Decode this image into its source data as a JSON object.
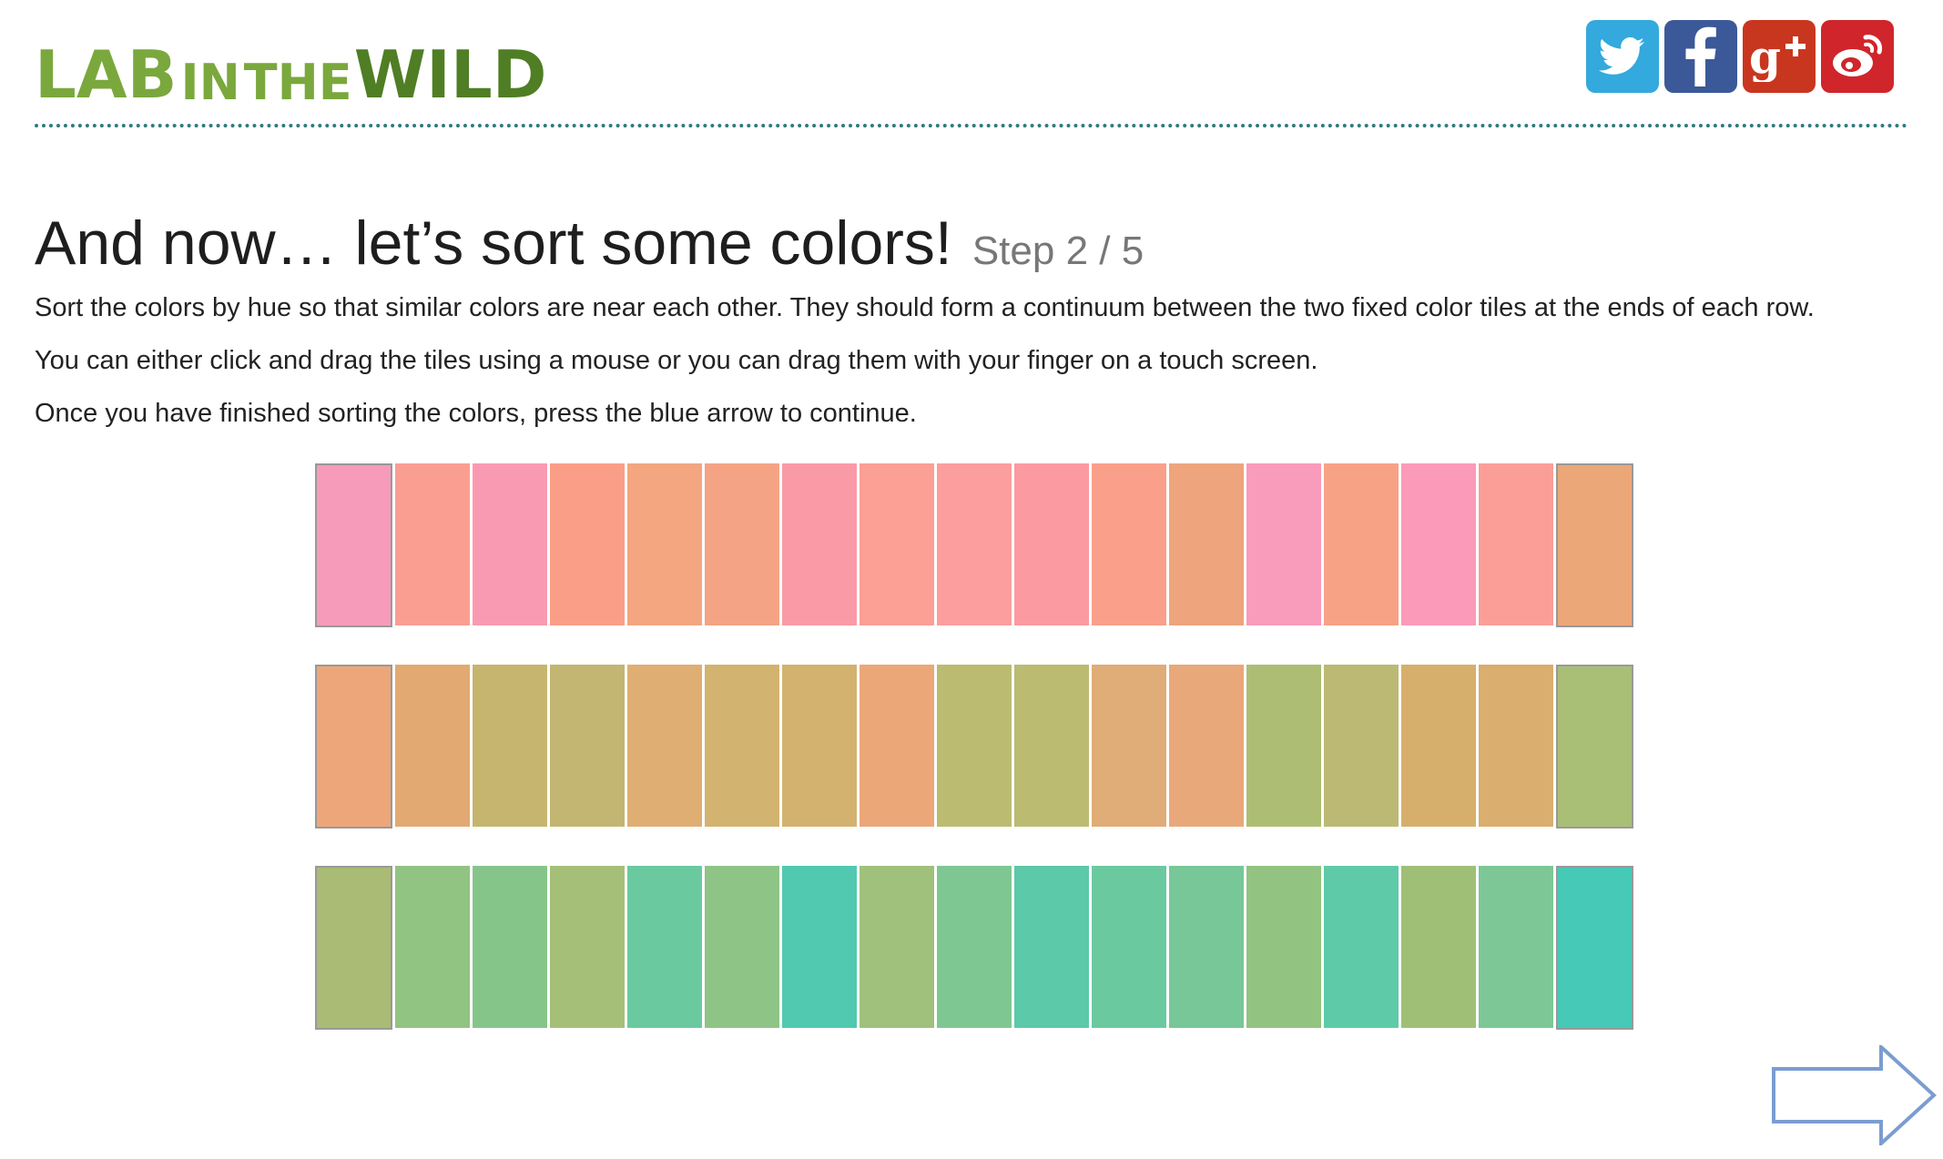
{
  "logo": {
    "part1": "LAB",
    "part2": "IN",
    "part3": "THE",
    "part4": "WILD"
  },
  "social": [
    {
      "name": "twitter",
      "icon": "twitter-icon",
      "color": "#33a9dd"
    },
    {
      "name": "facebook",
      "icon": "facebook-icon",
      "color": "#3b5998"
    },
    {
      "name": "google-plus",
      "icon": "google-plus-icon",
      "color": "#c9361f"
    },
    {
      "name": "weibo",
      "icon": "weibo-icon",
      "color": "#d0252b"
    }
  ],
  "page": {
    "title": "And now… let’s sort some colors!",
    "step": "Step 2 / 5",
    "instructions": [
      "Sort the colors by hue so that similar colors are near each other. They should form a continuum between the two fixed color tiles at the ends of each row.",
      "You can either click and drag the tiles using a mouse or you can drag them with your finger on a touch screen.",
      "Once you have finished sorting the colors, press the blue arrow to continue."
    ]
  },
  "rows": [
    [
      "#f79bbb",
      "#fa9e92",
      "#fa9ab2",
      "#fb9e87",
      "#f3a680",
      "#f4a485",
      "#fb9aa7",
      "#fc9f94",
      "#fc9d9e",
      "#fc9aa1",
      "#faa08a",
      "#eea47d",
      "#f99bba",
      "#f7a285",
      "#fb9ab9",
      "#fb9e98",
      "#eca779"
    ],
    [
      "#eda679",
      "#e2aa72",
      "#c6b56e",
      "#c2b672",
      "#dfae73",
      "#d2b36f",
      "#d3b270",
      "#eca779",
      "#bbbb72",
      "#bbbb72",
      "#e0ac77",
      "#e8a879",
      "#aebd74",
      "#bcb975",
      "#d7af6c",
      "#d9ae6e",
      "#a9bf76"
    ],
    [
      "#a9bb75",
      "#91c383",
      "#86c58a",
      "#a5bf79",
      "#6bc9a0",
      "#8ec485",
      "#51c9b0",
      "#9fc17b",
      "#7fc792",
      "#5cc9a8",
      "#6bc9a0",
      "#77c798",
      "#92c380",
      "#5fcaa7",
      "#9fbf77",
      "#7cc795",
      "#47c9b8"
    ]
  ],
  "next_button": {
    "icon": "right-arrow-icon",
    "color": "#7b9dd0"
  }
}
